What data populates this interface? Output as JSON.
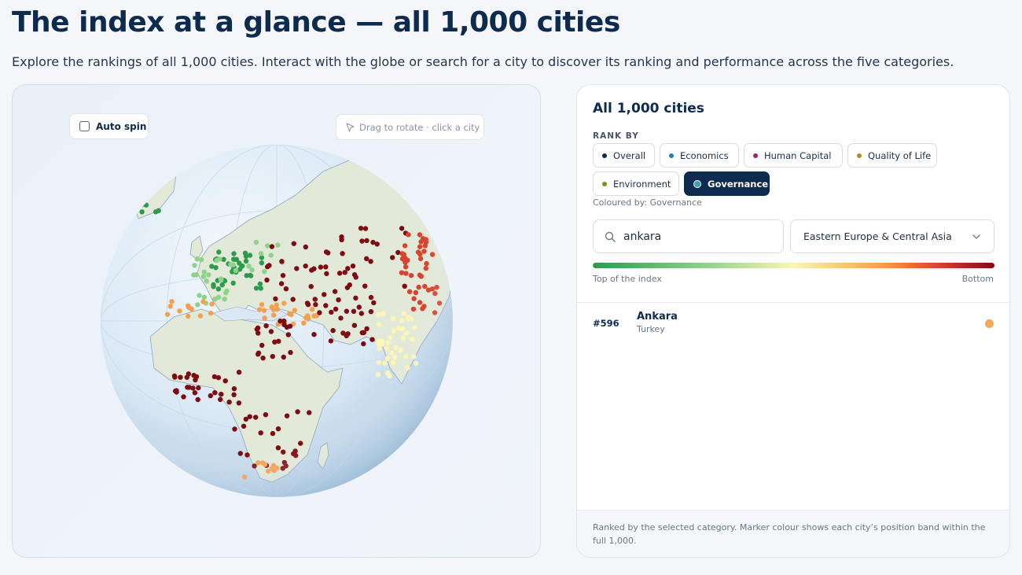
{
  "header": {
    "title": "The index at a glance — all 1,000 cities",
    "subtitle": "Explore the rankings of all 1,000 cities. Interact with the globe or search for a city to discover its ranking and performance across the five categories."
  },
  "globe": {
    "auto_spin_label": "Auto spin",
    "auto_spin_checked": false,
    "hint": "Drag to rotate · click a city"
  },
  "panel": {
    "title": "All 1,000 cities",
    "rank_by_label": "RANK BY",
    "categories": [
      {
        "label": "Overall",
        "color": "#0d2a4f",
        "active": false
      },
      {
        "label": "Economics",
        "color": "#1f7fb8",
        "active": false
      },
      {
        "label": "Human Capital",
        "color": "#a3216b",
        "active": false
      },
      {
        "label": "Quality of Life",
        "color": "#b58a2a",
        "active": false
      },
      {
        "label": "Environment",
        "color": "#6c9a1e",
        "active": false
      },
      {
        "label": "Governance",
        "color": "#3aa0b8",
        "active": true
      }
    ],
    "coloured_by": "Coloured by: Governance",
    "search": {
      "value": "ankara",
      "icon": "search-icon"
    },
    "region_select": {
      "value": "Eastern Europe & Central Asia",
      "icon": "chevron-down-icon"
    },
    "legend": {
      "top_label": "Top of the index",
      "bottom_label": "Bottom"
    },
    "results": [
      {
        "rank": "#596",
        "city": "Ankara",
        "country": "Turkey",
        "band_color": "#f4a85a"
      }
    ],
    "footer": "Ranked by the selected category. Marker colour shows each city’s position band within the full 1,000."
  },
  "colors": {
    "band_top": "#2e9a4c",
    "band_high": "#8fd28a",
    "band_mid": "#fbf6b5",
    "band_low": "#f5a04f",
    "band_lower": "#d8432e",
    "band_bottom": "#7d0d12"
  }
}
